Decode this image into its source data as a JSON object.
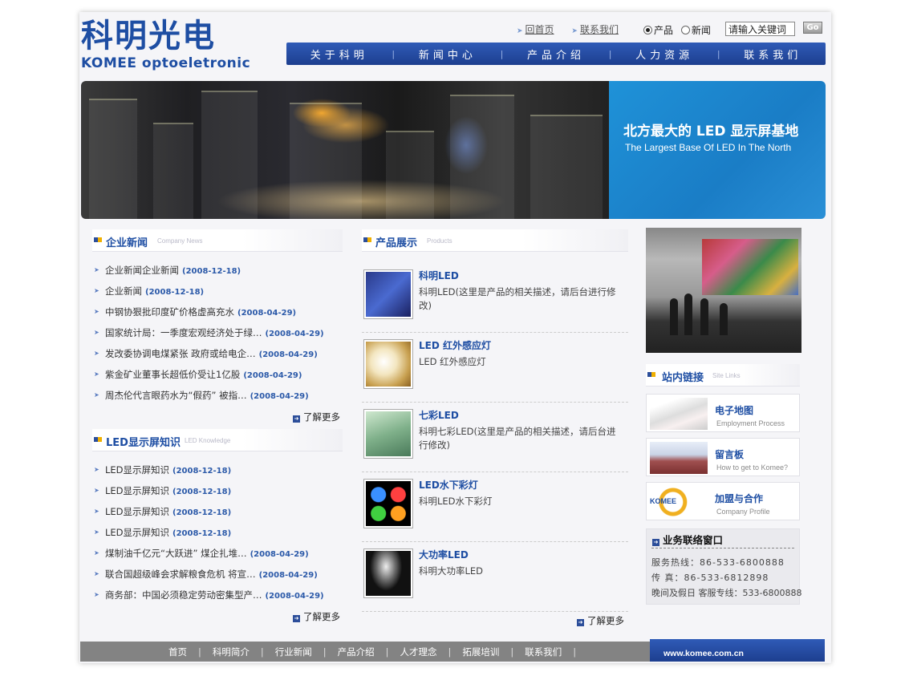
{
  "header": {
    "logo_cn": "科明光电",
    "logo_en": "KOMEE optoeletronic",
    "top_links": [
      "回首页",
      "联系我们"
    ],
    "search_scope": [
      "产品",
      "新闻"
    ],
    "search_scope_selected": "产品",
    "search_value": "请输入关键词",
    "go_label": "Go",
    "nav": [
      "关于科明",
      "新闻中心",
      "产品介绍",
      "人力资源",
      "联系我们"
    ]
  },
  "banner": {
    "title_cn": "北方最大的 LED 显示屏基地",
    "title_en": "The Largest Base Of LED In The North"
  },
  "news": {
    "title_cn": "企业新闻",
    "title_en": "Company News",
    "items": [
      {
        "text": "企业新闻企业新闻",
        "date": "(2008-12-18)"
      },
      {
        "text": "企业新闻",
        "date": "(2008-12-18)"
      },
      {
        "text": "中钢协狠批印度矿价格虚高充水",
        "date": "(2008-04-29)"
      },
      {
        "text": "国家统计局：一季度宏观经济处于绿…",
        "date": "(2008-04-29)"
      },
      {
        "text": "发改委协调电煤紧张 政府或给电企…",
        "date": "(2008-04-29)"
      },
      {
        "text": "紫金矿业董事长超低价受让1亿股",
        "date": "(2008-04-29)"
      },
      {
        "text": "周杰伦代言眼药水为“假药” 被指…",
        "date": "(2008-04-29)"
      }
    ],
    "more": "了解更多"
  },
  "knowledge": {
    "title_cn": "LED显示屏知识",
    "title_en": "LED Knowledge",
    "items": [
      {
        "text": "LED显示屏知识",
        "date": "(2008-12-18)"
      },
      {
        "text": "LED显示屏知识",
        "date": "(2008-12-18)"
      },
      {
        "text": "LED显示屏知识",
        "date": "(2008-12-18)"
      },
      {
        "text": "LED显示屏知识",
        "date": "(2008-12-18)"
      },
      {
        "text": "煤制油千亿元“大跃进” 煤企扎堆…",
        "date": "(2008-04-29)"
      },
      {
        "text": "联合国超级峰会求解粮食危机 将宣…",
        "date": "(2008-04-29)"
      },
      {
        "text": "商务部：中国必须稳定劳动密集型产…",
        "date": "(2008-04-29)"
      }
    ],
    "more": "了解更多"
  },
  "products": {
    "title_cn": "产品展示",
    "title_en": "Products",
    "items": [
      {
        "title": "科明LED",
        "desc": "科明LED(这里是产品的相关描述，请后台进行修改)"
      },
      {
        "title": "LED 红外感应灯",
        "desc": "LED 红外感应灯"
      },
      {
        "title": "七彩LED",
        "desc": "科明七彩LED(这里是产品的相关描述，请后台进行修改)"
      },
      {
        "title": "LED水下彩灯",
        "desc": "科明LED水下彩灯"
      },
      {
        "title": "大功率LED",
        "desc": "科明大功率LED"
      }
    ],
    "more": "了解更多"
  },
  "links": {
    "title_cn": "站内链接",
    "title_en": "Site Links",
    "items": [
      {
        "cn": "电子地图",
        "en": "Employment Process"
      },
      {
        "cn": "留言板",
        "en": "How to get to Komee?"
      },
      {
        "cn": "加盟与合作",
        "en": "Company Profile"
      }
    ],
    "logo_text": "KOMEE"
  },
  "contact": {
    "title": "业务联络窗口",
    "lines": [
      "服务热线：86-533-6800888",
      "传    真：86-533-6812898",
      "晚间及假日 客服专线：533-6800888"
    ]
  },
  "footer": {
    "links": [
      "首页",
      "科明简介",
      "行业新闻",
      "产品介绍",
      "人才理念",
      "拓展培训",
      "联系我们"
    ],
    "url": "www.komee.com.cn"
  },
  "colors": {
    "brand_blue": "#1e4ea3",
    "nav_blue": "#2f5bb7",
    "banner_blue": "#1a7dc6",
    "date_blue": "#2c5aa9",
    "footer_gray": "#838383"
  }
}
